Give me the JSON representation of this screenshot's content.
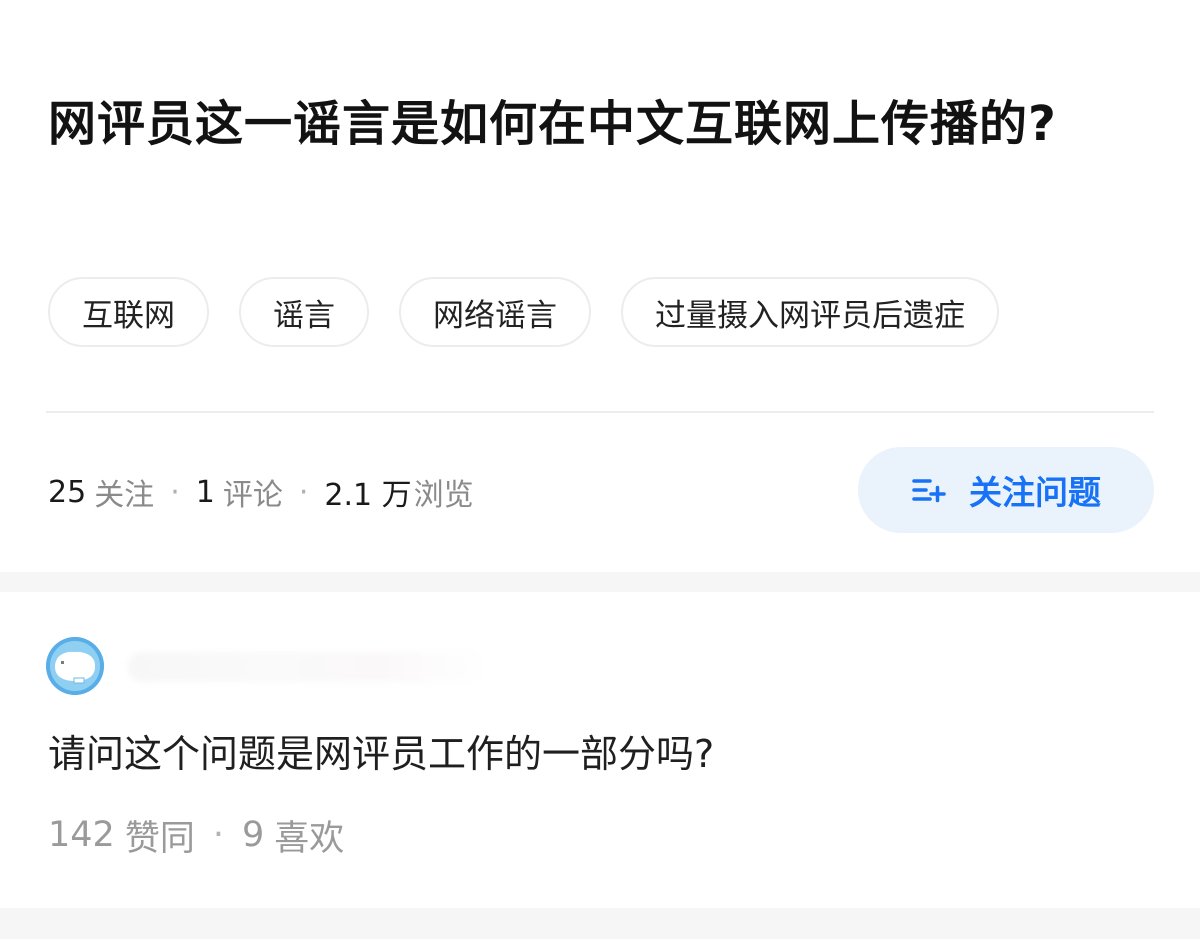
{
  "question": {
    "title": "网评员这一谣言是如何在中文互联网上传播的?",
    "tags": [
      "互联网",
      "谣言",
      "网络谣言",
      "过量摄入网评员后遗症"
    ],
    "stats": {
      "followers_count": "25",
      "followers_label": "关注",
      "comments_count": "1",
      "comments_label": "评论",
      "views_count": "2.1 万",
      "views_label": "浏览",
      "separator": "·"
    },
    "follow_button": {
      "label": "关注问题",
      "icon": "add-follow-icon",
      "color": "#1772f6",
      "background": "#eaf2fc"
    }
  },
  "comment": {
    "avatar_icon": "avatar-icon",
    "username_blurred": true,
    "text": "请问这个问题是网评员工作的一部分吗?",
    "likes_count": "142",
    "likes_label": "赞同",
    "favorites_count": "9",
    "favorites_label": "喜欢",
    "separator": "·"
  }
}
